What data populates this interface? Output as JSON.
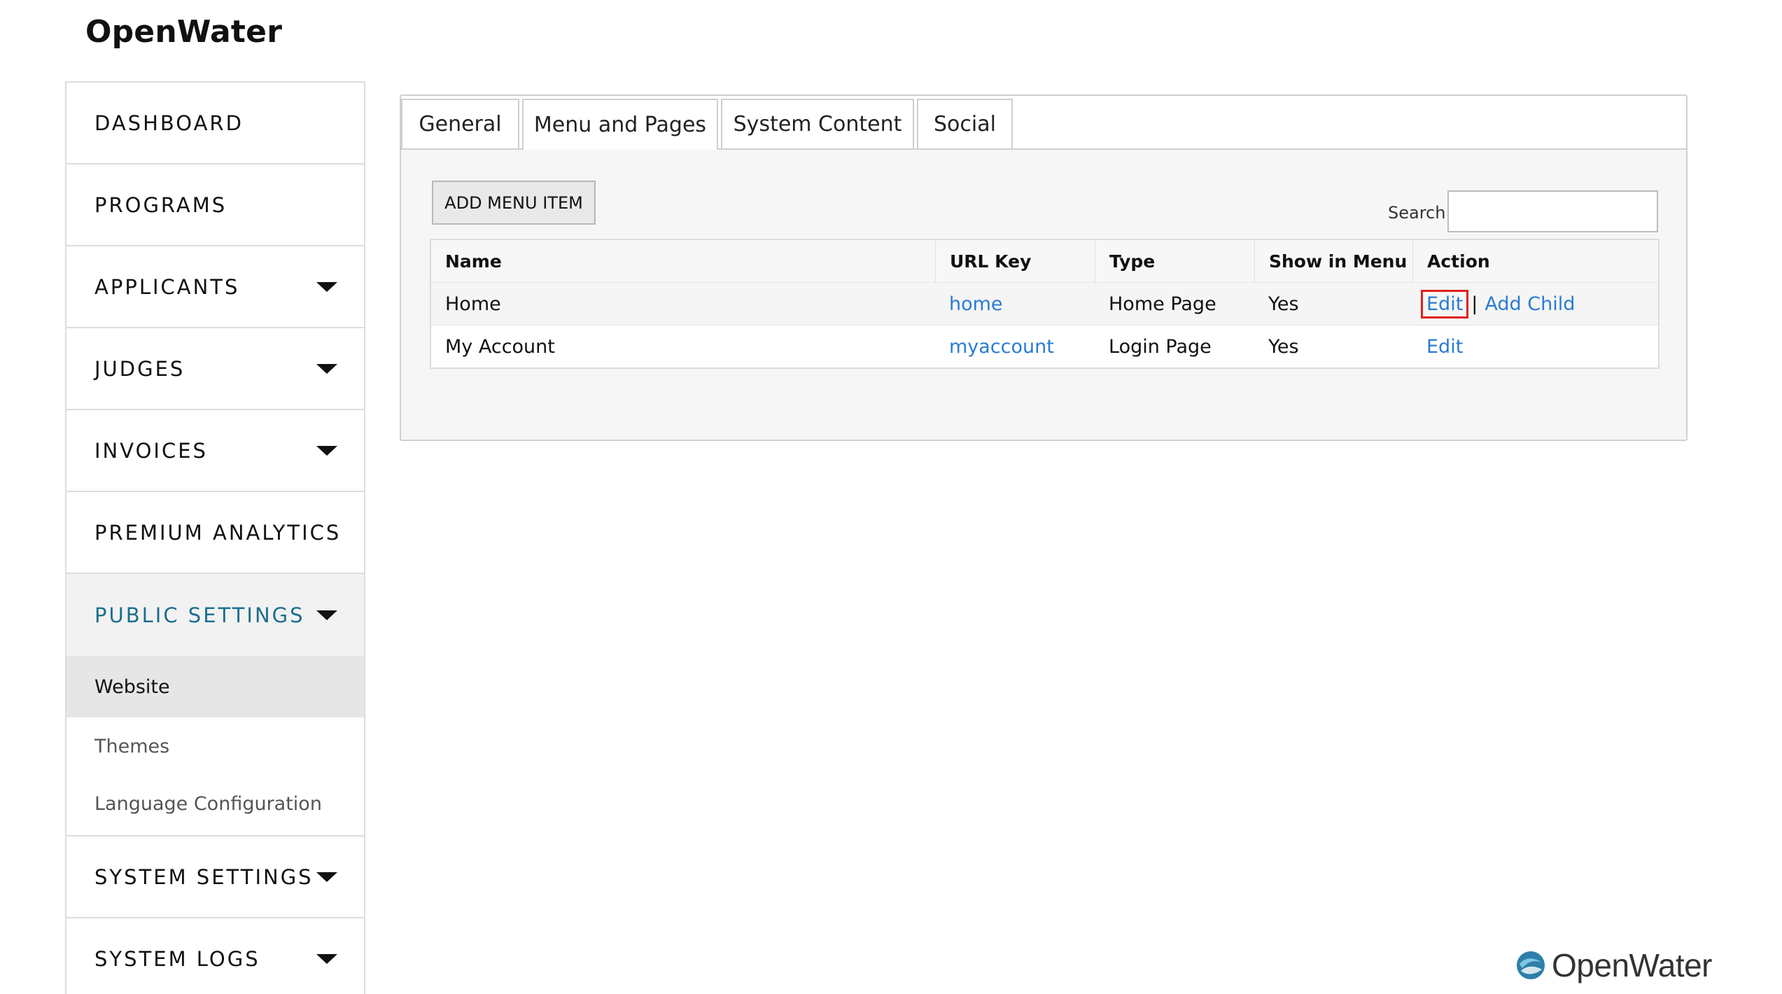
{
  "app": {
    "title": "OpenWater"
  },
  "sidebar": {
    "items": [
      {
        "label": "DASHBOARD"
      },
      {
        "label": "PROGRAMS"
      },
      {
        "label": "APPLICANTS"
      },
      {
        "label": "JUDGES"
      },
      {
        "label": "INVOICES"
      },
      {
        "label": "PREMIUM ANALYTICS"
      },
      {
        "label": "PUBLIC SETTINGS"
      },
      {
        "label": "SYSTEM SETTINGS"
      },
      {
        "label": "SYSTEM LOGS"
      }
    ],
    "public_settings_sub": [
      {
        "label": "Website"
      },
      {
        "label": "Themes"
      },
      {
        "label": "Language Configuration"
      }
    ]
  },
  "tabs": [
    {
      "label": "General"
    },
    {
      "label": "Menu and Pages"
    },
    {
      "label": "System Content"
    },
    {
      "label": "Social"
    }
  ],
  "toolbar": {
    "add_label": "ADD MENU ITEM",
    "search_label": "Search:",
    "search_value": ""
  },
  "table": {
    "columns": [
      "Name",
      "URL Key",
      "Type",
      "Show in Menu",
      "Action"
    ],
    "rows": [
      {
        "name": "Home",
        "url_key": "home",
        "type": "Home Page",
        "show": "Yes",
        "edit": "Edit",
        "add_child": "Add Child"
      },
      {
        "name": "My Account",
        "url_key": "myaccount",
        "type": "Login Page",
        "show": "Yes",
        "edit": "Edit"
      }
    ]
  },
  "footer": {
    "logo_text": "OpenWater"
  },
  "colors": {
    "link": "#2a7bd3",
    "active_nav": "#1d6f8e",
    "highlight": "#e0201b"
  }
}
